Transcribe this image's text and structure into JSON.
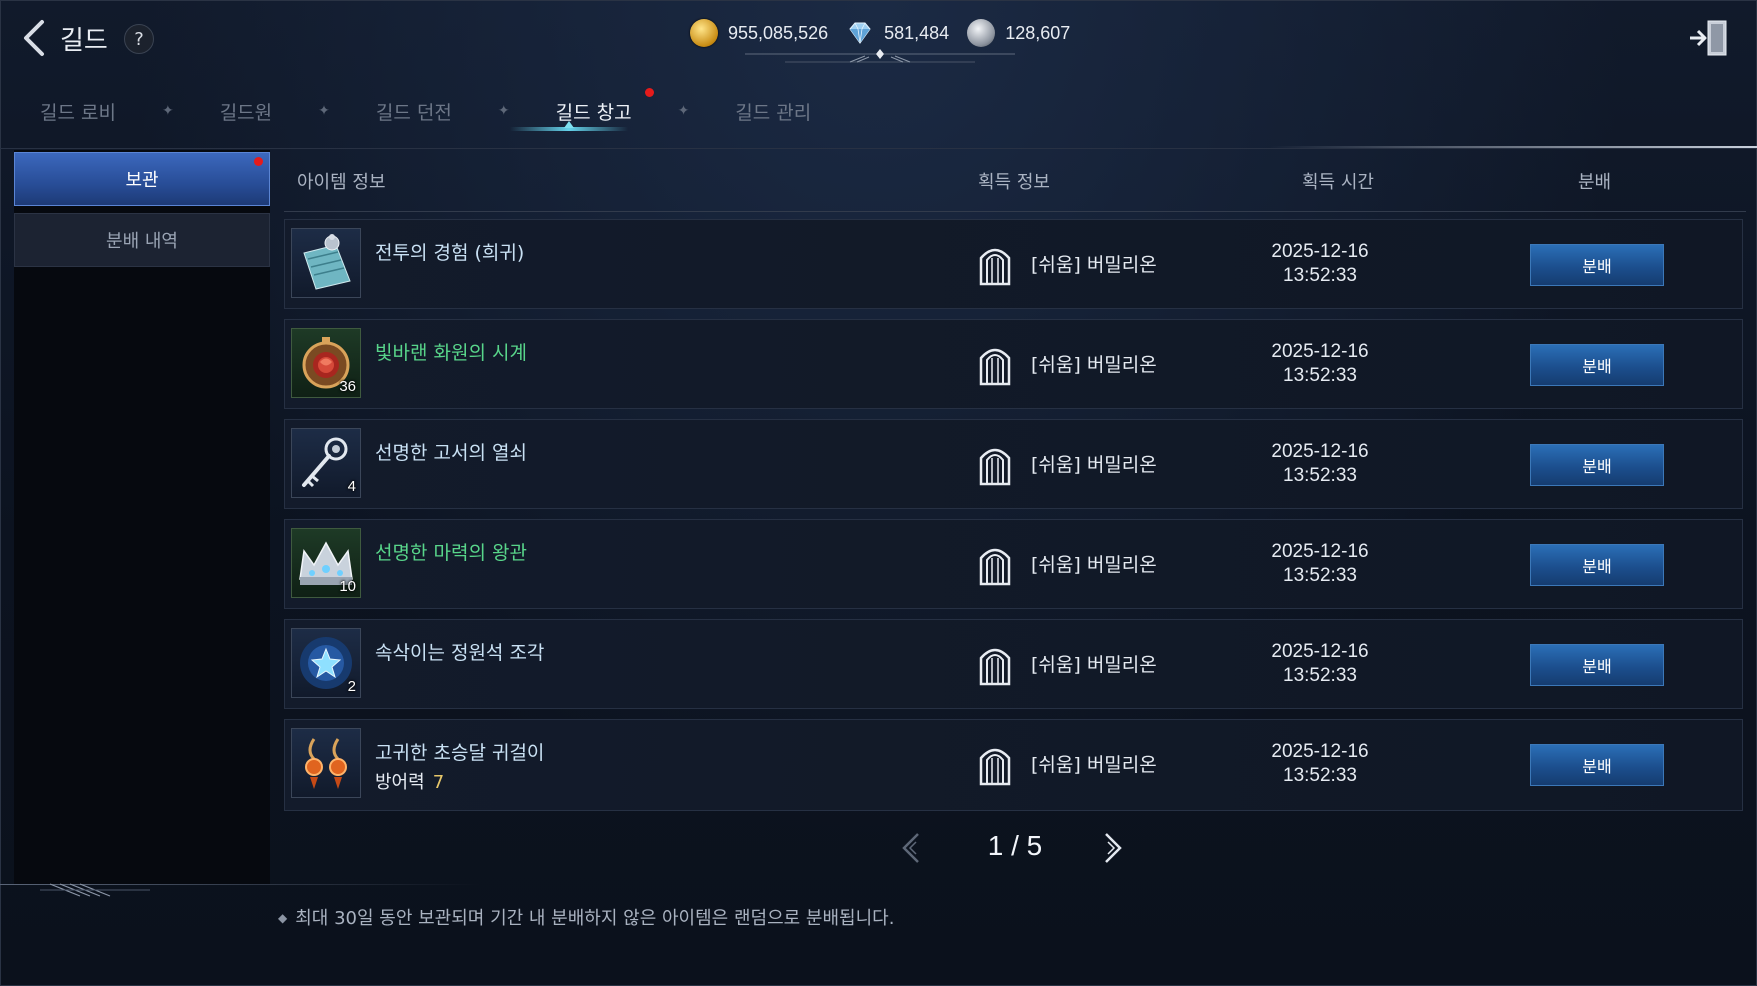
{
  "header": {
    "title": "길드",
    "help": "?",
    "currencies": [
      {
        "icon": "gold-coin-icon",
        "value": "955,085,526"
      },
      {
        "icon": "diamond-icon",
        "value": "581,484"
      },
      {
        "icon": "silver-coin-icon",
        "value": "128,607"
      }
    ]
  },
  "tabs": [
    {
      "label": "길드 로비",
      "active": false
    },
    {
      "label": "길드원",
      "active": false
    },
    {
      "label": "길드 던전",
      "active": false
    },
    {
      "label": "길드 창고",
      "active": true,
      "notification": true
    },
    {
      "label": "길드 관리",
      "active": false
    }
  ],
  "sidebar": {
    "items": [
      {
        "label": "보관",
        "active": true,
        "notification": true
      },
      {
        "label": "분배 내역",
        "active": false
      }
    ]
  },
  "table": {
    "headers": {
      "item_info": "아이템 정보",
      "acquire_info": "획득 정보",
      "acquire_time": "획득 시간",
      "distribute": "분배"
    },
    "rows": [
      {
        "name": "전투의 경험 (희귀)",
        "name_color": "default",
        "qty": "",
        "sub_label": "",
        "sub_value": "",
        "icon": "scroll-icon",
        "acquire": "[쉬움] 버밀리온",
        "date": "2025-12-16",
        "time": "13:52:33",
        "button": "분배"
      },
      {
        "name": "빛바랜 화원의 시계",
        "name_color": "green",
        "qty": "36",
        "sub_label": "",
        "sub_value": "",
        "icon": "pocket-watch-icon",
        "acquire": "[쉬움] 버밀리온",
        "date": "2025-12-16",
        "time": "13:52:33",
        "button": "분배"
      },
      {
        "name": "선명한 고서의 열쇠",
        "name_color": "default",
        "qty": "4",
        "sub_label": "",
        "sub_value": "",
        "icon": "key-icon",
        "acquire": "[쉬움] 버밀리온",
        "date": "2025-12-16",
        "time": "13:52:33",
        "button": "분배"
      },
      {
        "name": "선명한 마력의 왕관",
        "name_color": "green",
        "qty": "10",
        "sub_label": "",
        "sub_value": "",
        "icon": "crown-icon",
        "acquire": "[쉬움] 버밀리온",
        "date": "2025-12-16",
        "time": "13:52:33",
        "button": "분배"
      },
      {
        "name": "속삭이는 정원석 조각",
        "name_color": "default",
        "qty": "2",
        "sub_label": "",
        "sub_value": "",
        "icon": "star-stone-icon",
        "acquire": "[쉬움] 버밀리온",
        "date": "2025-12-16",
        "time": "13:52:33",
        "button": "분배"
      },
      {
        "name": "고귀한 초승달 귀걸이",
        "name_color": "default",
        "qty": "",
        "sub_label": "방어력",
        "sub_value": "7",
        "icon": "earrings-icon",
        "acquire": "[쉬움] 버밀리온",
        "date": "2025-12-16",
        "time": "13:52:33",
        "button": "분배"
      }
    ]
  },
  "pagination": {
    "text": "1 / 5",
    "current": 1,
    "total": 5
  },
  "footer": {
    "notice": "최대 30일 동안 보관되며 기간 내 분배하지 않은 아이템은 랜덤으로 분배됩니다."
  },
  "colors": {
    "accent_blue": "#2b6fb7",
    "green_name": "#58d58a",
    "notification_red": "#e51b1b",
    "value_gold": "#e7c76a"
  }
}
